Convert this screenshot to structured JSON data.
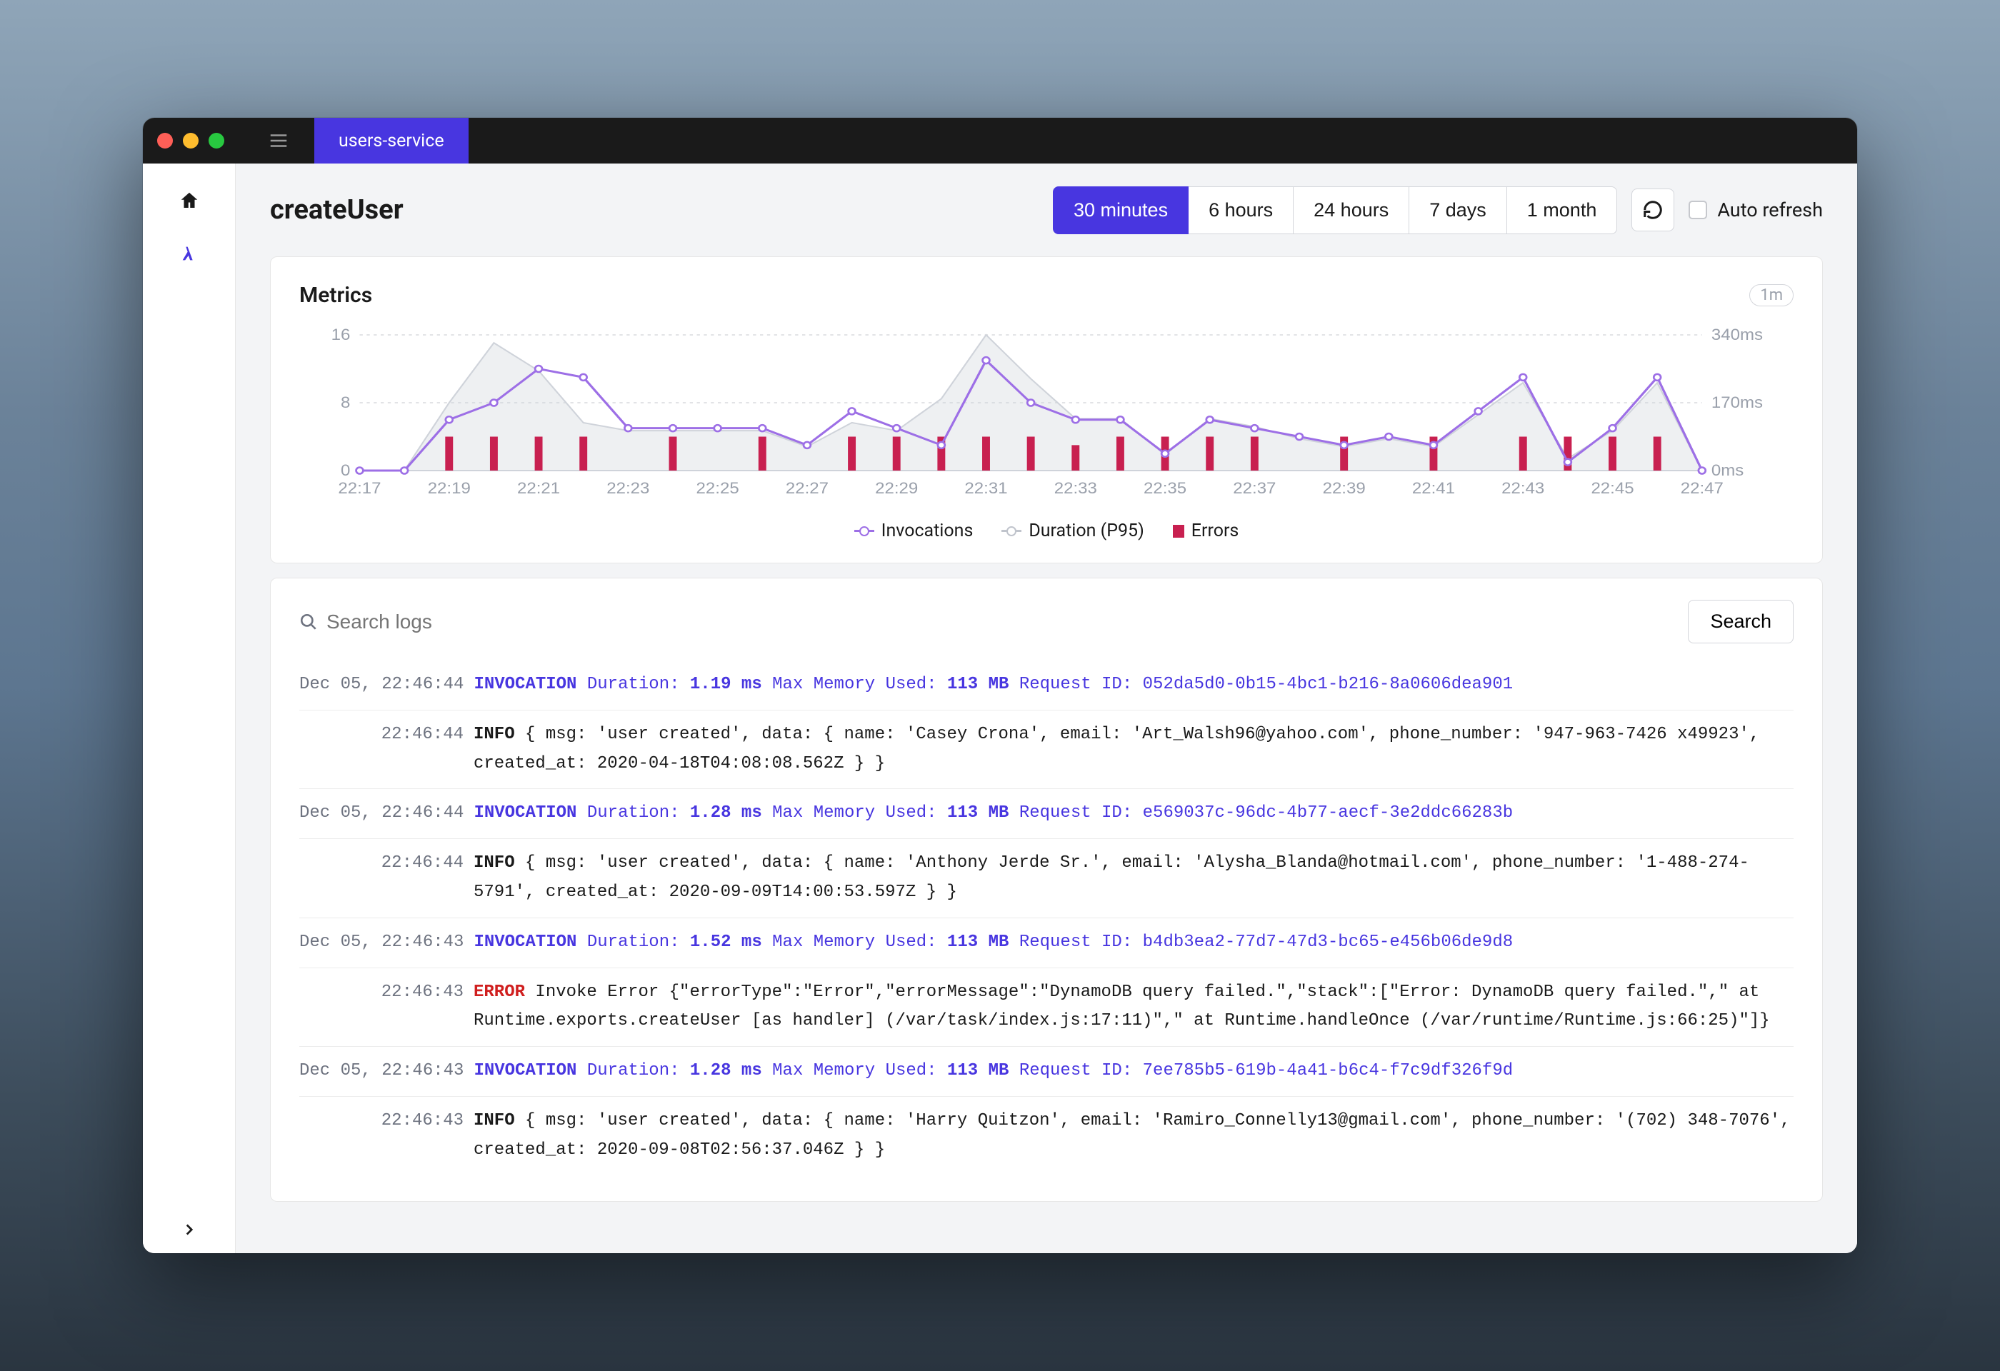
{
  "titlebar": {
    "tab_label": "users-service"
  },
  "page": {
    "title": "createUser",
    "ranges": [
      "30 minutes",
      "6 hours",
      "24 hours",
      "7 days",
      "1 month"
    ],
    "active_range": 0,
    "auto_refresh_label": "Auto refresh"
  },
  "metrics": {
    "title": "Metrics",
    "badge": "1m",
    "legend": {
      "invocations": "Invocations",
      "duration": "Duration (P95)",
      "errors": "Errors"
    }
  },
  "chart_data": {
    "type": "line",
    "x": [
      "22:17",
      "22:18",
      "22:19",
      "22:20",
      "22:21",
      "22:22",
      "22:23",
      "22:24",
      "22:25",
      "22:26",
      "22:27",
      "22:28",
      "22:29",
      "22:30",
      "22:31",
      "22:32",
      "22:33",
      "22:34",
      "22:35",
      "22:36",
      "22:37",
      "22:38",
      "22:39",
      "22:40",
      "22:41",
      "22:42",
      "22:43",
      "22:44",
      "22:45",
      "22:46",
      "22:47"
    ],
    "x_ticks": [
      "22:17",
      "22:19",
      "22:21",
      "22:23",
      "22:25",
      "22:27",
      "22:29",
      "22:31",
      "22:33",
      "22:35",
      "22:37",
      "22:39",
      "22:41",
      "22:43",
      "22:45",
      "22:47"
    ],
    "left_axis": {
      "label": "",
      "ticks": [
        0,
        8,
        16
      ],
      "lim": [
        0,
        16
      ]
    },
    "right_axis": {
      "label": "",
      "ticks": [
        "0ms",
        "170ms",
        "340ms"
      ],
      "lim": [
        0,
        340
      ]
    },
    "series": [
      {
        "name": "Invocations",
        "axis": "left",
        "type": "line",
        "color": "#9d6fe6",
        "values": [
          0,
          0,
          6,
          8,
          12,
          11,
          5,
          5,
          5,
          5,
          3,
          7,
          5,
          3,
          13,
          8,
          6,
          6,
          2,
          6,
          5,
          4,
          3,
          4,
          3,
          7,
          11,
          1,
          5,
          11,
          0
        ]
      },
      {
        "name": "Duration (P95)",
        "axis": "right",
        "type": "area",
        "color": "#cfd3da",
        "values": [
          0,
          0,
          170,
          320,
          250,
          120,
          100,
          100,
          100,
          100,
          60,
          120,
          100,
          180,
          340,
          230,
          130,
          130,
          40,
          130,
          110,
          80,
          60,
          80,
          60,
          140,
          220,
          30,
          100,
          220,
          0
        ]
      },
      {
        "name": "Errors",
        "axis": "left",
        "type": "bar",
        "color": "#c82050",
        "values": [
          0,
          0,
          4,
          4,
          4,
          4,
          0,
          4,
          0,
          4,
          0,
          4,
          4,
          4,
          4,
          4,
          3,
          4,
          4,
          4,
          4,
          0,
          4,
          0,
          4,
          0,
          4,
          4,
          4,
          4,
          0
        ]
      }
    ]
  },
  "logs": {
    "search_placeholder": "Search logs",
    "search_button": "Search",
    "entries": [
      {
        "ts": "Dec 05, 22:46:44",
        "type": "invocation",
        "duration": "1.19 ms",
        "memory": "113 MB",
        "request_id": "052da5d0-0b15-4bc1-b216-8a0606dea901"
      },
      {
        "ts": "22:46:44",
        "type": "info",
        "body": "{ msg: 'user created', data: { name: 'Casey Crona', email: 'Art_Walsh96@yahoo.com', phone_number: '947-963-7426 x49923', created_at: 2020-04-18T04:08:08.562Z } }"
      },
      {
        "ts": "Dec 05, 22:46:44",
        "type": "invocation",
        "duration": "1.28 ms",
        "memory": "113 MB",
        "request_id": "e569037c-96dc-4b77-aecf-3e2ddc66283b"
      },
      {
        "ts": "22:46:44",
        "type": "info",
        "body": "{ msg: 'user created', data: { name: 'Anthony Jerde Sr.', email: 'Alysha_Blanda@hotmail.com', phone_number: '1-488-274-5791', created_at: 2020-09-09T14:00:53.597Z } }"
      },
      {
        "ts": "Dec 05, 22:46:43",
        "type": "invocation",
        "duration": "1.52 ms",
        "memory": "113 MB",
        "request_id": "b4db3ea2-77d7-47d3-bc65-e456b06de9d8"
      },
      {
        "ts": "22:46:43",
        "type": "error",
        "body": "Invoke Error {\"errorType\":\"Error\",\"errorMessage\":\"DynamoDB query failed.\",\"stack\":[\"Error: DynamoDB query failed.\",\" at Runtime.exports.createUser [as handler] (/var/task/index.js:17:11)\",\" at Runtime.handleOnce (/var/runtime/Runtime.js:66:25)\"]}"
      },
      {
        "ts": "Dec 05, 22:46:43",
        "type": "invocation",
        "duration": "1.28 ms",
        "memory": "113 MB",
        "request_id": "7ee785b5-619b-4a41-b6c4-f7c9df326f9d"
      },
      {
        "ts": "22:46:43",
        "type": "info",
        "body": "{ msg: 'user created', data: { name: 'Harry Quitzon', email: 'Ramiro_Connelly13@gmail.com', phone_number: '(702) 348-7076', created_at: 2020-09-08T02:56:37.046Z } }"
      }
    ]
  }
}
